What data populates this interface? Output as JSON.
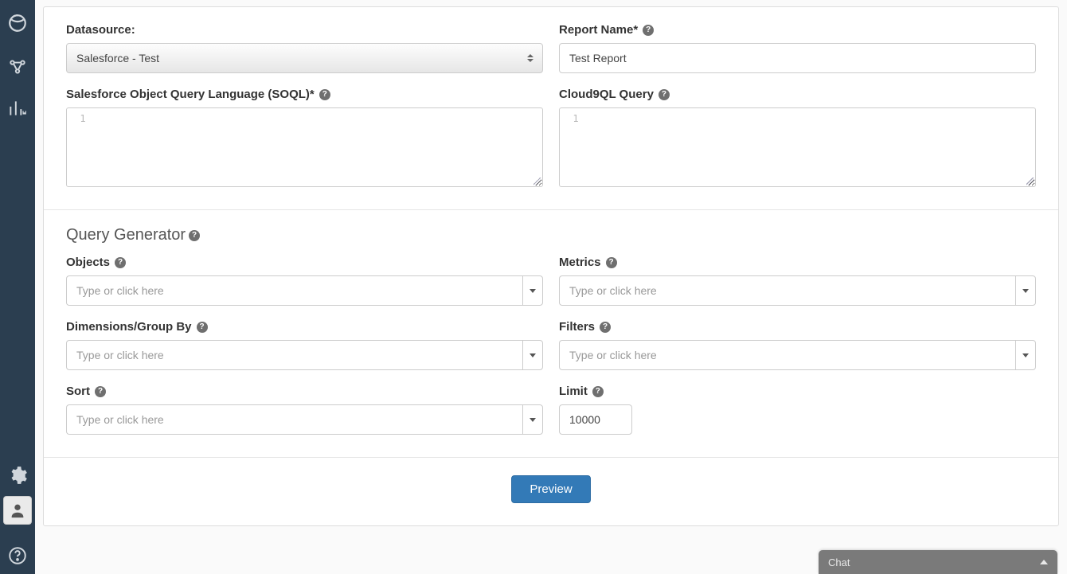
{
  "sidebar": {
    "items": [
      {
        "name": "logo"
      },
      {
        "name": "connectors"
      },
      {
        "name": "reports"
      },
      {
        "name": "settings"
      },
      {
        "name": "user"
      },
      {
        "name": "help"
      }
    ]
  },
  "form": {
    "datasource": {
      "label": "Datasource:",
      "value": "Salesforce - Test"
    },
    "report_name": {
      "label": "Report Name*",
      "value": "Test Report"
    },
    "soql": {
      "label": "Salesforce Object Query Language (SOQL)*",
      "gutter": "1",
      "value": ""
    },
    "c9ql": {
      "label": "Cloud9QL Query",
      "gutter": "1",
      "value": ""
    }
  },
  "query_generator": {
    "heading": "Query Generator",
    "objects": {
      "label": "Objects",
      "placeholder": "Type or click here"
    },
    "metrics": {
      "label": "Metrics",
      "placeholder": "Type or click here"
    },
    "dimensions": {
      "label": "Dimensions/Group By",
      "placeholder": "Type or click here"
    },
    "filters": {
      "label": "Filters",
      "placeholder": "Type or click here"
    },
    "sort": {
      "label": "Sort",
      "placeholder": "Type or click here"
    },
    "limit": {
      "label": "Limit",
      "value": "10000"
    }
  },
  "actions": {
    "preview": "Preview"
  },
  "chat": {
    "label": "Chat"
  },
  "help_glyph": "?"
}
